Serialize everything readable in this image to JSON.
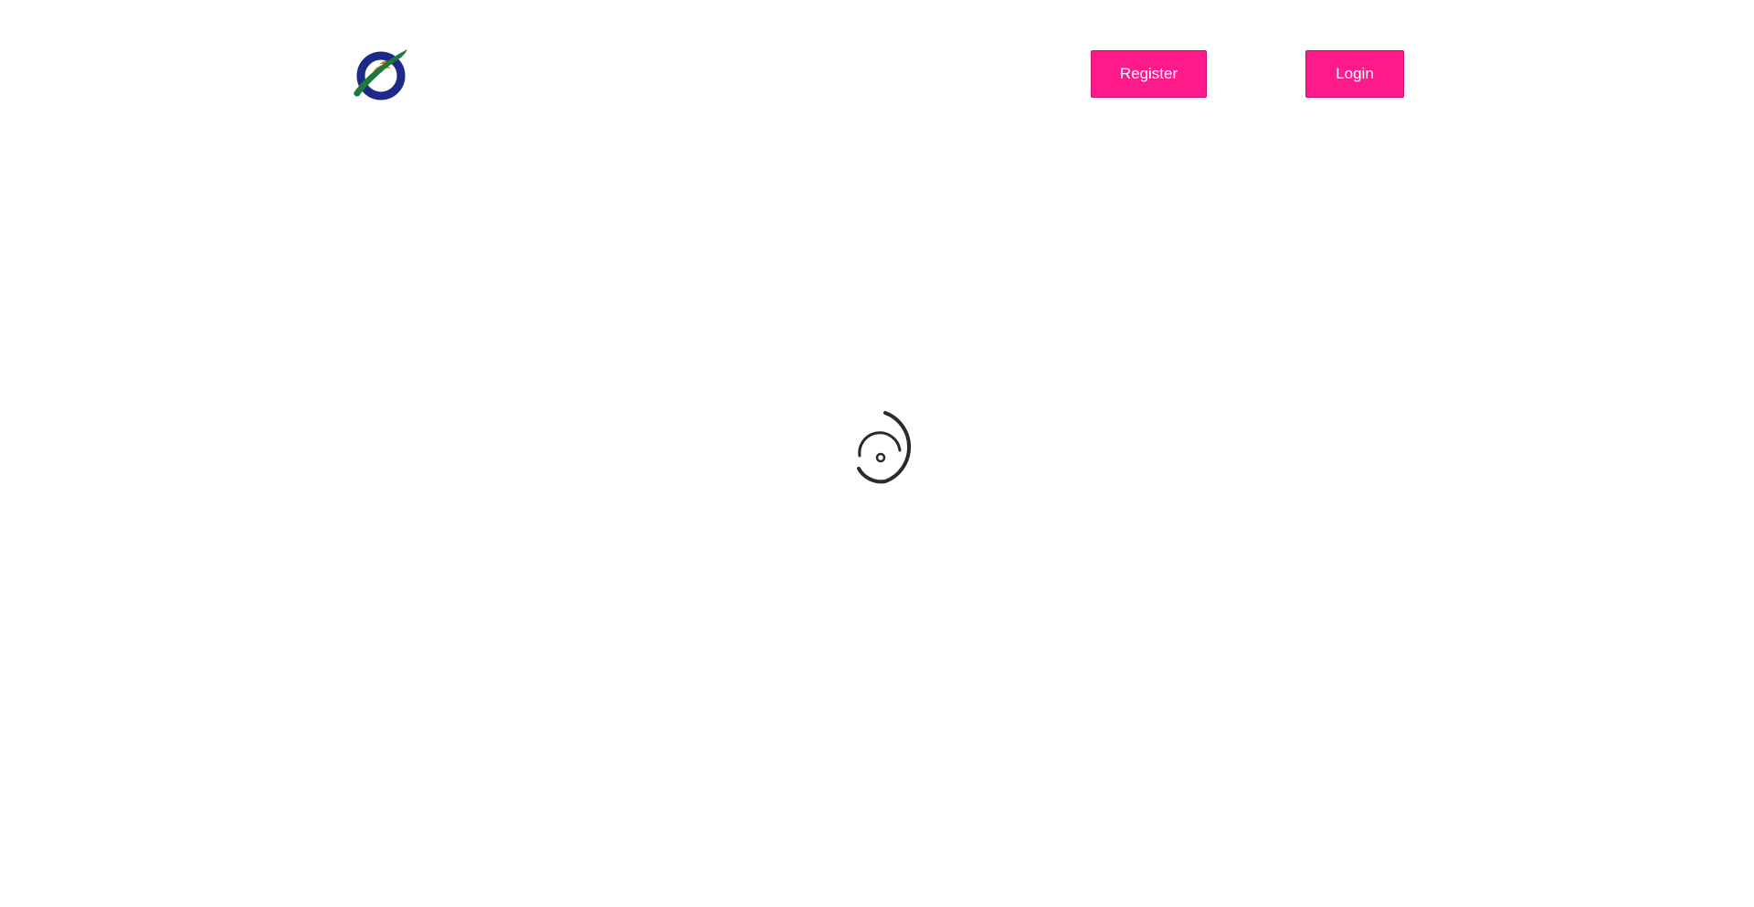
{
  "header": {
    "logo_icon": "planet-orbit-logo-icon",
    "register_label": "Register",
    "login_label": "Login"
  },
  "loader": {
    "icon": "loading-spinner-icon"
  },
  "colors": {
    "accent": "#ff1a8c",
    "logo_navy": "#1d2a8a",
    "logo_orange": "#f26b21",
    "logo_green": "#1d7a3a",
    "spinner": "#2b2b2b"
  }
}
